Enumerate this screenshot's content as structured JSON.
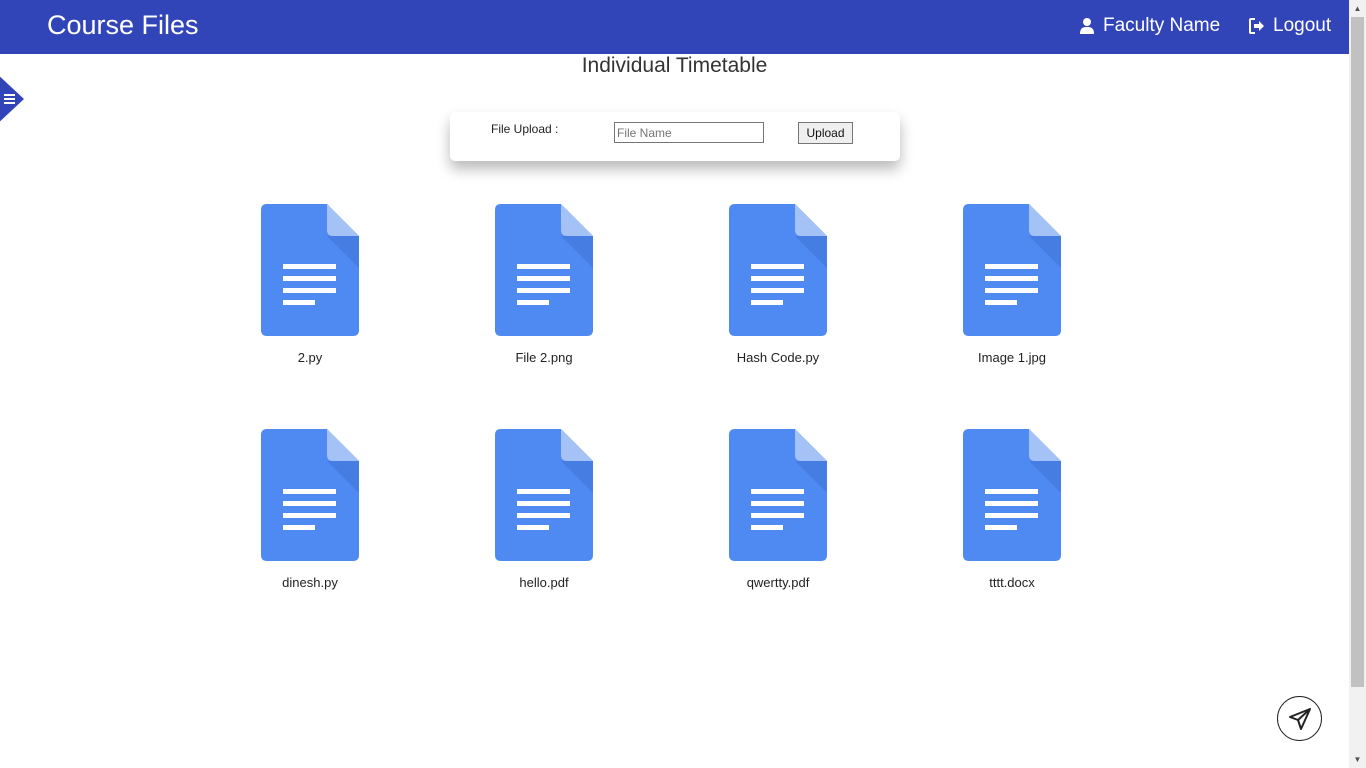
{
  "header": {
    "brand": "Course Files",
    "user_label": "Faculty Name",
    "logout_label": "Logout",
    "background": "#3245b8"
  },
  "icons": {
    "sidebar_toggle": "hamburger-icon",
    "user": "user-icon",
    "logout": "sign-out-icon",
    "file": "document-icon",
    "send": "paper-plane-icon"
  },
  "main": {
    "title": "Individual Timetable"
  },
  "upload": {
    "label": "File Upload :",
    "input_value": "",
    "input_placeholder": "File Name",
    "button_label": "Upload"
  },
  "files": [
    {
      "name": "2.py"
    },
    {
      "name": "File 2.png"
    },
    {
      "name": "Hash Code.py"
    },
    {
      "name": "Image 1.jpg"
    },
    {
      "name": "dinesh.py"
    },
    {
      "name": "hello.pdf"
    },
    {
      "name": "qwertty.pdf"
    },
    {
      "name": "tttt.docx"
    }
  ],
  "colors": {
    "file_icon": "#4e8af1",
    "file_fold": "#a4c2f6",
    "accent": "#3245b8"
  }
}
